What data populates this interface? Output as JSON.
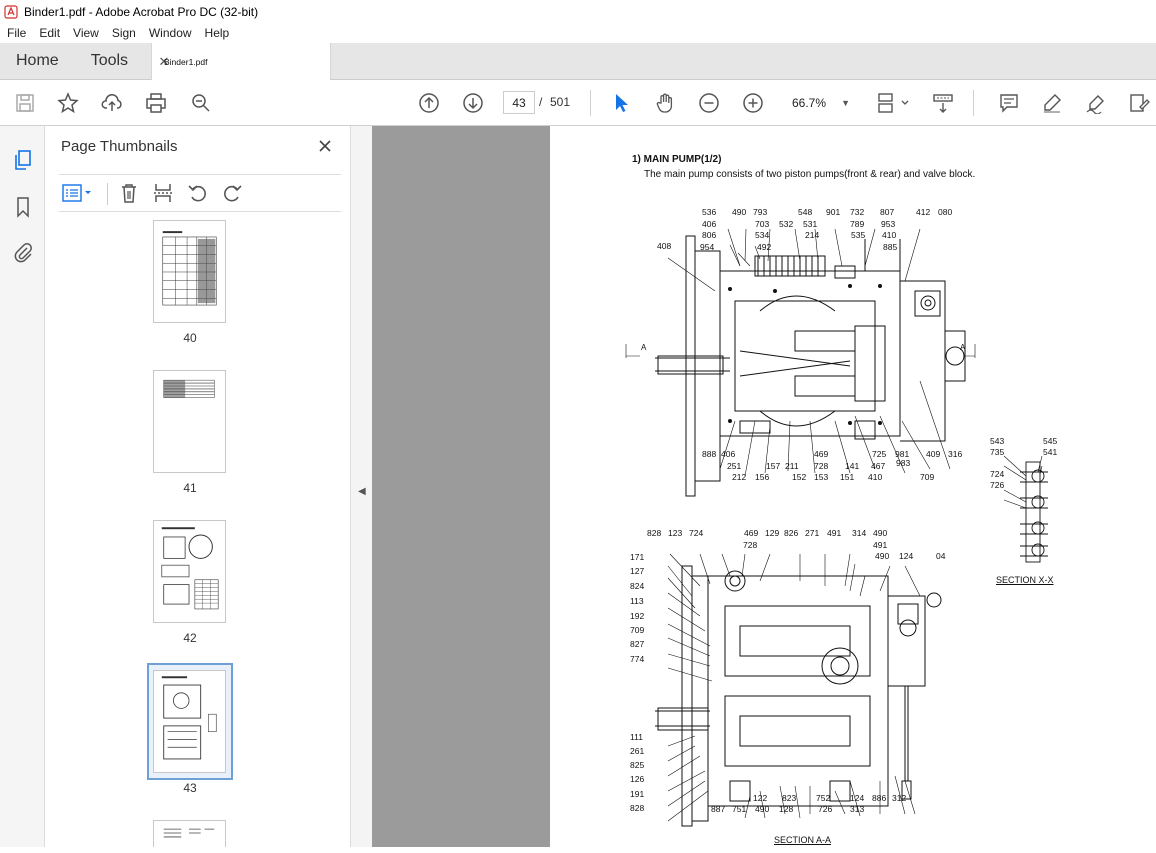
{
  "window": {
    "title": "Binder1.pdf - Adobe Acrobat Pro DC (32-bit)"
  },
  "menu": [
    "File",
    "Edit",
    "View",
    "Sign",
    "Window",
    "Help"
  ],
  "tabs": {
    "home": "Home",
    "tools": "Tools",
    "document": "Binder1.pdf"
  },
  "toolbar": {
    "current_page": "43",
    "page_sep": "/",
    "total_pages": "501",
    "zoom": "66.7%"
  },
  "thumbnails": {
    "title": "Page Thumbnails",
    "pages": [
      "40",
      "41",
      "42",
      "43"
    ],
    "selected": "43"
  },
  "document": {
    "heading": "1)  MAIN PUMP(1/2)",
    "subheading": "The main pump consists of two piston pumps(front & rear) and valve block.",
    "section_aa": "SECTION  A-A",
    "section_xx": "SECTION  X-X",
    "callouts_top": [
      "536",
      "490",
      "793",
      "548",
      "901",
      "732",
      "807",
      "412",
      "080",
      "406",
      "703",
      "532",
      "531",
      "789",
      "953",
      "806",
      "534",
      "214",
      "535",
      "410",
      "408",
      "954",
      "492",
      "885"
    ],
    "callouts_top_bottom": [
      "888",
      "406",
      "251",
      "212",
      "157",
      "211",
      "156",
      "469",
      "728",
      "152",
      "153",
      "141",
      "151",
      "725",
      "467",
      "410",
      "981",
      "983",
      "709",
      "409",
      "316"
    ],
    "callouts_xx": [
      "543",
      "545",
      "735",
      "541",
      "724",
      "726"
    ],
    "callouts_aa_top": [
      "828",
      "123",
      "724",
      "469",
      "129",
      "826",
      "271",
      "491",
      "314",
      "490",
      "728",
      "491",
      "490",
      "124",
      "04"
    ],
    "callouts_aa_left": [
      "171",
      "127",
      "824",
      "113",
      "192",
      "709",
      "827",
      "774",
      "111",
      "261",
      "825",
      "126",
      "191",
      "828"
    ],
    "callouts_aa_bottom": [
      "887",
      "751",
      "490",
      "122",
      "128",
      "823",
      "752",
      "726",
      "124",
      "313",
      "886",
      "312"
    ],
    "marker_a": "A",
    "marker_x": "X"
  },
  "colors": {
    "canvas": "#9b9b9b",
    "accent_blue": "#1473e6",
    "selection": "#6e9fd6"
  }
}
